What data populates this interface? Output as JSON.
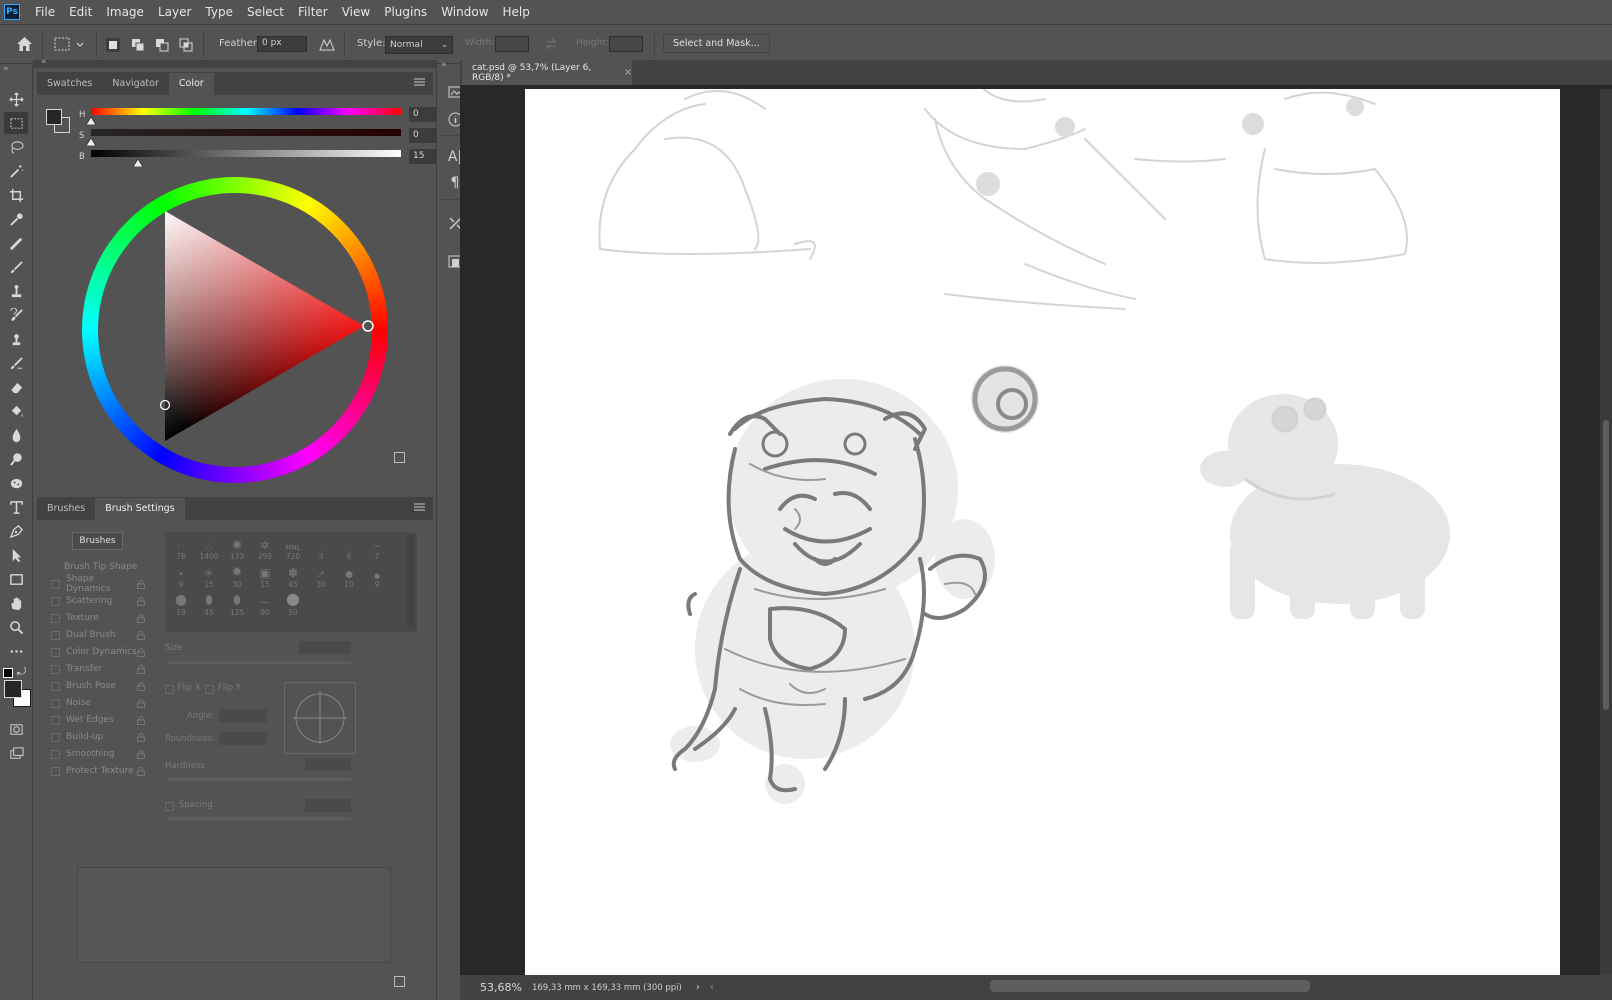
{
  "app": {
    "logo": "Ps"
  },
  "menu": [
    "File",
    "Edit",
    "Image",
    "Layer",
    "Type",
    "Select",
    "Filter",
    "View",
    "Plugins",
    "Window",
    "Help"
  ],
  "options": {
    "feather_label": "Feather:",
    "feather_value": "0 px",
    "style_label": "Style:",
    "style_value": "Normal",
    "width_label": "Width:",
    "height_label": "Height:",
    "select_mask": "Select and Mask..."
  },
  "color_panel": {
    "tabs": [
      "Swatches",
      "Navigator",
      "Color"
    ],
    "active_tab": "Color",
    "h_label": "H",
    "s_label": "S",
    "b_label": "B",
    "h_value": "0",
    "s_value": "0",
    "b_value": "15",
    "h_unit": "°",
    "s_unit": "%",
    "b_unit": "%",
    "hue": 0,
    "saturation": 0,
    "brightness": 15
  },
  "brush_panel": {
    "tabs": [
      "Brushes",
      "Brush Settings"
    ],
    "active_tab": "Brush Settings",
    "brushes_button": "Brushes",
    "settings": [
      "Brush Tip Shape",
      "Shape Dynamics",
      "Scattering",
      "Texture",
      "Dual Brush",
      "Color Dynamics",
      "Transfer",
      "Brush Pose",
      "Noise",
      "Wet Edges",
      "Build-up",
      "Smoothing",
      "Protect Texture"
    ],
    "tip_sizes": [
      "76",
      "1400",
      "173",
      "298",
      "720",
      "3",
      "6",
      "7",
      "9",
      "15",
      "30",
      "15",
      "45",
      "30",
      "10",
      "9",
      "19",
      "45",
      "125",
      "90",
      "50"
    ],
    "size_label": "Size",
    "flip_x": "Flip X",
    "flip_y": "Flip Y",
    "angle_label": "Angle:",
    "roundness_label": "Roundness:",
    "hardness_label": "Hardness",
    "spacing_label": "Spacing"
  },
  "document": {
    "tab_title": "cat.psd @ 53,7% (Layer 6, RGB/8) *",
    "zoom": "53,68%",
    "info": "169,33 mm x 169,33 mm (300 ppi)"
  },
  "colors": {
    "ui_bg": "#535353",
    "panel_dark": "#424242",
    "workspace": "#282828",
    "foreground_swatch": "#262626",
    "background_swatch": "#ffffff",
    "accent_ps": "#31a8ff"
  }
}
